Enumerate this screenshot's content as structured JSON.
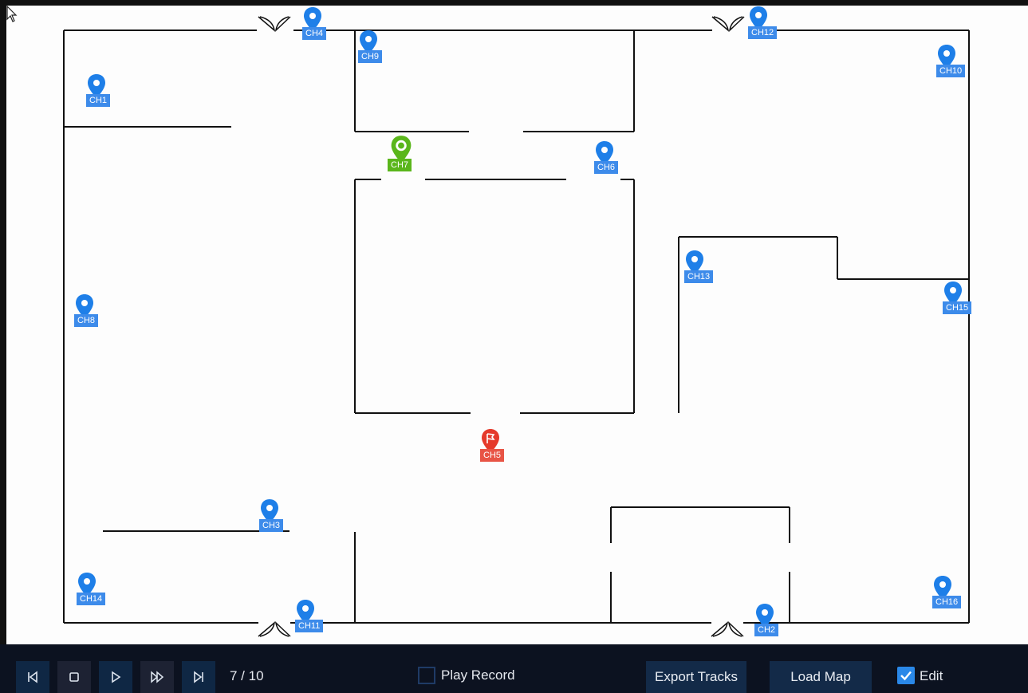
{
  "map": {
    "cameras": [
      {
        "id": "ch1",
        "label": "CH1",
        "state": "normal"
      },
      {
        "id": "ch2",
        "label": "CH2",
        "state": "normal"
      },
      {
        "id": "ch3",
        "label": "CH3",
        "state": "normal"
      },
      {
        "id": "ch4",
        "label": "CH4",
        "state": "normal"
      },
      {
        "id": "ch5",
        "label": "CH5",
        "state": "alarm"
      },
      {
        "id": "ch6",
        "label": "CH6",
        "state": "normal"
      },
      {
        "id": "ch7",
        "label": "CH7",
        "state": "selected"
      },
      {
        "id": "ch8",
        "label": "CH8",
        "state": "normal"
      },
      {
        "id": "ch9",
        "label": "CH9",
        "state": "normal"
      },
      {
        "id": "ch10",
        "label": "CH10",
        "state": "normal"
      },
      {
        "id": "ch11",
        "label": "CH11",
        "state": "normal"
      },
      {
        "id": "ch12",
        "label": "CH12",
        "state": "normal"
      },
      {
        "id": "ch13",
        "label": "CH13",
        "state": "normal"
      },
      {
        "id": "ch14",
        "label": "CH14",
        "state": "normal"
      },
      {
        "id": "ch15",
        "label": "CH15",
        "state": "normal"
      },
      {
        "id": "ch16",
        "label": "CH16",
        "state": "normal"
      }
    ],
    "colors": {
      "normal": "#1e7fe8",
      "selected": "#5ab61b",
      "alarm": "#e53a2b",
      "wall": "#111111"
    }
  },
  "toolbar": {
    "buttons": [
      {
        "id": "skip-previous",
        "icon": "skip-previous-icon"
      },
      {
        "id": "stop",
        "icon": "stop-icon"
      },
      {
        "id": "play",
        "icon": "play-icon"
      },
      {
        "id": "fast-forward",
        "icon": "fast-forward-icon"
      },
      {
        "id": "skip-next",
        "icon": "skip-next-icon"
      }
    ],
    "page_counter": "7 / 10",
    "play_record_label": "Play Record",
    "play_record_checked": false,
    "export_tracks_label": "Export Tracks",
    "load_map_label": "Load Map",
    "edit_label": "Edit",
    "edit_checked": true
  }
}
